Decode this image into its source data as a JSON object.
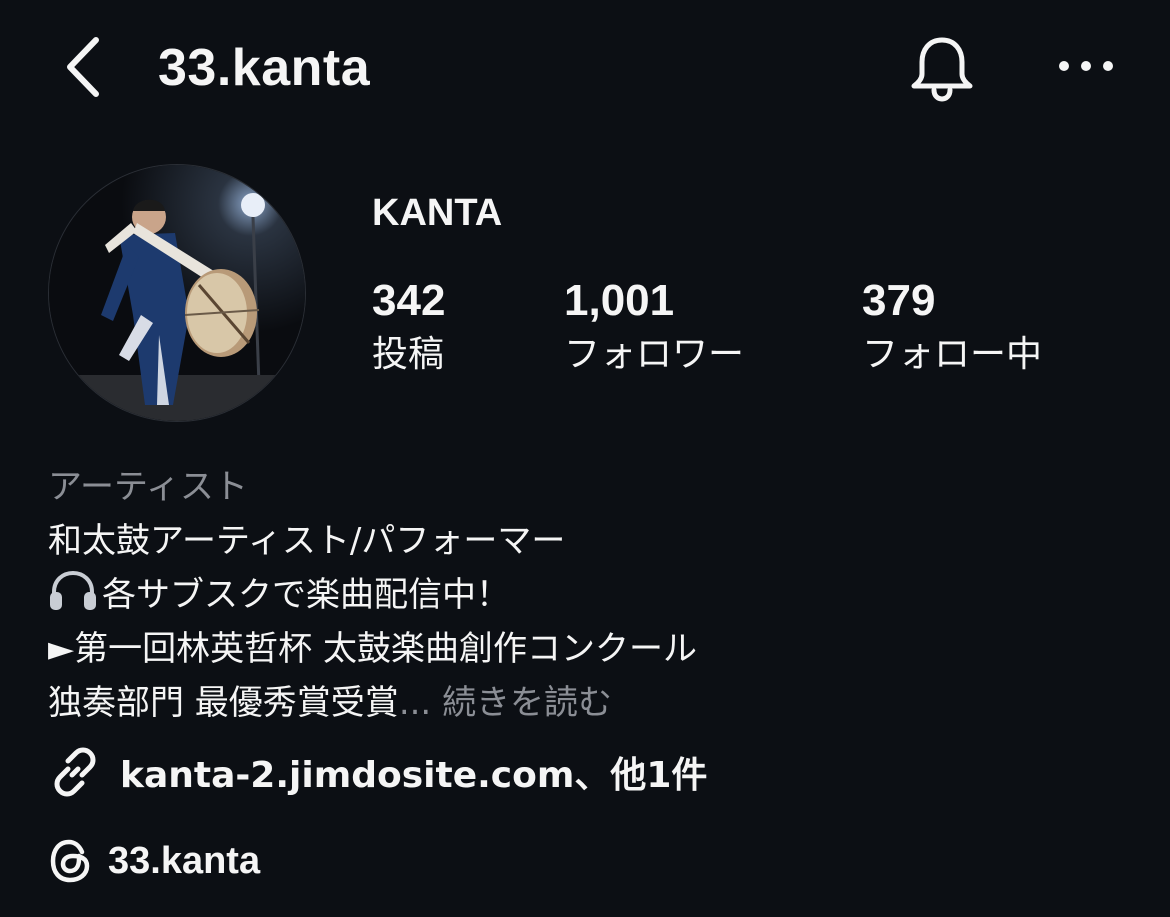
{
  "header": {
    "username": "33.kanta",
    "back_icon": "chevron-left-icon",
    "bell_icon": "bell-icon",
    "more_icon": "more-horizontal-icon"
  },
  "profile": {
    "display_name": "KANTA",
    "stats": {
      "posts": {
        "value": "342",
        "label": "投稿"
      },
      "followers": {
        "value": "1,001",
        "label": "フォロワー"
      },
      "following": {
        "value": "379",
        "label": "フォロー中"
      }
    }
  },
  "bio": {
    "category": "アーティスト",
    "line1": "和太鼓アーティスト/パフォーマー",
    "line2_text": "各サブスクで楽曲配信中！",
    "line2_icon": "headphones-icon",
    "line3": "►第一回林英哲杯 太鼓楽曲創作コンクール",
    "line4": "独奏部門 最優秀賞受賞",
    "ellipsis": "...",
    "read_more": "続きを読む"
  },
  "links": {
    "website": "kanta-2.jimdosite.com、他1件",
    "website_icon": "link-icon",
    "threads": "33.kanta",
    "threads_icon": "threads-icon"
  },
  "colors": {
    "background": "#0c0f14",
    "text": "#f5f5f5",
    "muted": "#8b8e95"
  }
}
